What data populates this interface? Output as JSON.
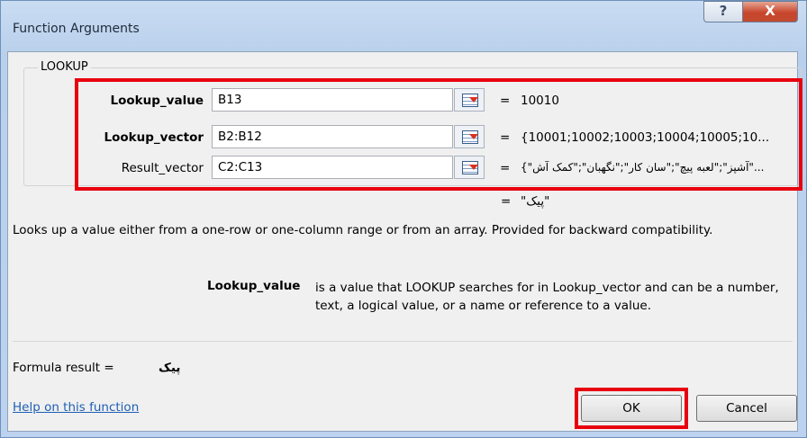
{
  "window": {
    "title": "Function Arguments",
    "help_glyph": "?",
    "close_glyph": "X"
  },
  "group": {
    "label": "LOOKUP"
  },
  "args": [
    {
      "label": "Lookup_value",
      "value": "B13",
      "result": "10010"
    },
    {
      "label": "Lookup_vector",
      "value": "B2:B12",
      "result": "{10001;10002;10003;10004;10005;10..."
    },
    {
      "label": "Result_vector",
      "value": "C2:C13",
      "result": "{\"آشپز\";\"لعبه پیچ\";\"سان کار\";\"نگهبان\";\"کمک آش\"..."
    }
  ],
  "equals": "=",
  "overall_result": "\"پیک\"",
  "description": "Looks up a value either from a one-row or one-column range or from an array. Provided for backward compatibility.",
  "arg_help": {
    "name": "Lookup_value",
    "text": "is a value that LOOKUP searches for in Lookup_vector and can be a number, text, a logical value, or a name or reference to a value."
  },
  "formula_result": {
    "label": "Formula result =",
    "value": "پیک"
  },
  "footer": {
    "help_link": "Help on this function",
    "ok": "OK",
    "cancel": "Cancel"
  },
  "colors": {
    "highlight": "#e8000e",
    "link": "#1e5fb4"
  }
}
